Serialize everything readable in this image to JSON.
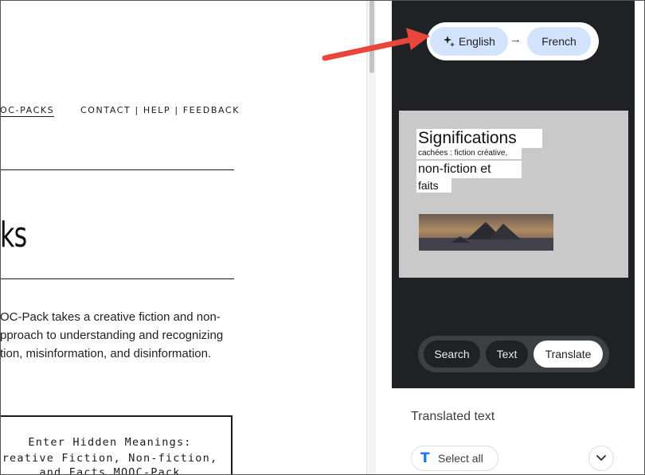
{
  "page": {
    "nav": {
      "mooc_packs": "OC-PACKS",
      "links": "CONTACT | HELP | FEEDBACK"
    },
    "heading_fragment": "ks",
    "description_lines": [
      "OC-Pack takes a creative fiction and non-",
      "pproach to understanding and recognizing",
      "tion, misinformation, and disinformation."
    ],
    "card_lines": [
      "Enter Hidden Meanings:",
      "reative Fiction, Non-fiction,",
      "and Facts MOOC-Pack"
    ]
  },
  "lens_panel": {
    "source_language": "English",
    "arrow_icon": "arrow-right-icon",
    "target_language": "French",
    "translated_overlay": {
      "line1": "Significations",
      "line2": "cachées : fiction créative,",
      "line3": "non-fiction et",
      "line4": "faits"
    },
    "modes": {
      "search": "Search",
      "text": "Text",
      "translate": "Translate",
      "active": "Translate"
    },
    "translated_text_heading": "Translated text",
    "select_all_label": "Select all",
    "colors": {
      "panel_bg": "#202124",
      "pill_bg": "#d3e3fd",
      "annotation_arrow": "#e8453c"
    }
  }
}
